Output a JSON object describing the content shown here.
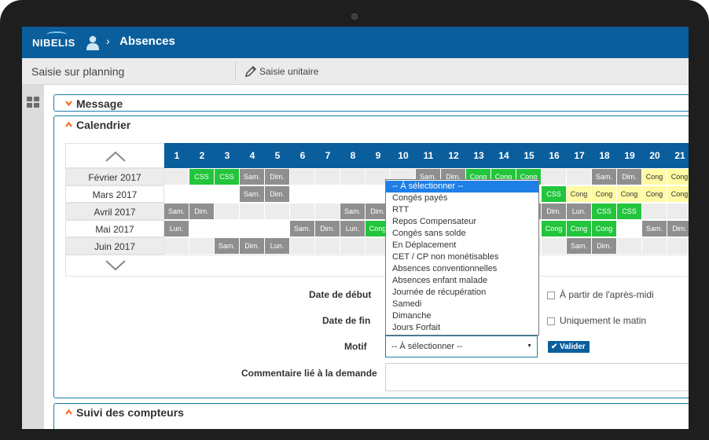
{
  "header": {
    "logo": "NIBELIS",
    "separator": "›",
    "title": "Absences"
  },
  "subheader": {
    "title": "Saisie sur planning",
    "action": "Saisie unitaire"
  },
  "panels": {
    "message": "Message",
    "calendrier": "Calendrier",
    "suivi": "Suivi des compteurs"
  },
  "calendar": {
    "days": [
      "1",
      "2",
      "3",
      "4",
      "5",
      "6",
      "7",
      "8",
      "9",
      "10",
      "11",
      "12",
      "13",
      "14",
      "15",
      "16",
      "17",
      "18",
      "19",
      "20",
      "21"
    ],
    "months": [
      {
        "label": "Février 2017",
        "cells": [
          {
            "d": 1,
            "t": "",
            "c": "light"
          },
          {
            "d": 2,
            "t": "CSS",
            "c": "green"
          },
          {
            "d": 3,
            "t": "CSS",
            "c": "green"
          },
          {
            "d": 4,
            "t": "Sam.",
            "c": "grey"
          },
          {
            "d": 5,
            "t": "Dim.",
            "c": "grey"
          },
          {
            "d": 6,
            "t": "",
            "c": "light"
          },
          {
            "d": 7,
            "t": "",
            "c": "light"
          },
          {
            "d": 8,
            "t": "",
            "c": "light"
          },
          {
            "d": 9,
            "t": "",
            "c": "light"
          },
          {
            "d": 10,
            "t": "",
            "c": "light"
          },
          {
            "d": 11,
            "t": "Sam.",
            "c": "grey"
          },
          {
            "d": 12,
            "t": "Dim.",
            "c": "grey"
          },
          {
            "d": 13,
            "t": "Cong",
            "c": "green"
          },
          {
            "d": 14,
            "t": "Cong",
            "c": "green"
          },
          {
            "d": 15,
            "t": "Cong",
            "c": "green"
          },
          {
            "d": 16,
            "t": "",
            "c": "light"
          },
          {
            "d": 17,
            "t": "",
            "c": "light"
          },
          {
            "d": 18,
            "t": "Sam.",
            "c": "grey"
          },
          {
            "d": 19,
            "t": "Dim.",
            "c": "grey"
          },
          {
            "d": 20,
            "t": "Cong",
            "c": "yellow"
          },
          {
            "d": 21,
            "t": "Cong",
            "c": "yellow"
          }
        ]
      },
      {
        "label": "Mars 2017",
        "cells": [
          {
            "d": 1,
            "t": "",
            "c": "white"
          },
          {
            "d": 2,
            "t": "",
            "c": "white"
          },
          {
            "d": 3,
            "t": "",
            "c": "white"
          },
          {
            "d": 4,
            "t": "Sam.",
            "c": "grey"
          },
          {
            "d": 5,
            "t": "Dim.",
            "c": "grey"
          },
          {
            "d": 6,
            "t": "",
            "c": "white"
          },
          {
            "d": 7,
            "t": "",
            "c": "white"
          },
          {
            "d": 8,
            "t": "",
            "c": "white"
          },
          {
            "d": 9,
            "t": "",
            "c": "white"
          },
          {
            "d": 10,
            "t": "",
            "c": "white"
          },
          {
            "d": 11,
            "t": "",
            "c": "white"
          },
          {
            "d": 12,
            "t": "",
            "c": "white"
          },
          {
            "d": 13,
            "t": "",
            "c": "white"
          },
          {
            "d": 14,
            "t": "",
            "c": "white"
          },
          {
            "d": 15,
            "t": "",
            "c": "white"
          },
          {
            "d": 16,
            "t": "CSS",
            "c": "green"
          },
          {
            "d": 17,
            "t": "Cong",
            "c": "yellow"
          },
          {
            "d": 18,
            "t": "Cong",
            "c": "yellow"
          },
          {
            "d": 19,
            "t": "Cong",
            "c": "yellow"
          },
          {
            "d": 20,
            "t": "Cong",
            "c": "yellow"
          },
          {
            "d": 21,
            "t": "Cong",
            "c": "yellow"
          }
        ]
      },
      {
        "label": "Avril 2017",
        "cells": [
          {
            "d": 1,
            "t": "Sam.",
            "c": "grey"
          },
          {
            "d": 2,
            "t": "Dim.",
            "c": "grey"
          },
          {
            "d": 3,
            "t": "",
            "c": "light"
          },
          {
            "d": 4,
            "t": "",
            "c": "light"
          },
          {
            "d": 5,
            "t": "",
            "c": "light"
          },
          {
            "d": 6,
            "t": "",
            "c": "light"
          },
          {
            "d": 7,
            "t": "",
            "c": "light"
          },
          {
            "d": 8,
            "t": "Sam.",
            "c": "grey"
          },
          {
            "d": 9,
            "t": "Dim.",
            "c": "grey"
          },
          {
            "d": 10,
            "t": "",
            "c": "light"
          },
          {
            "d": 11,
            "t": "",
            "c": "light"
          },
          {
            "d": 12,
            "t": "",
            "c": "light"
          },
          {
            "d": 13,
            "t": "",
            "c": "light"
          },
          {
            "d": 14,
            "t": "",
            "c": "light"
          },
          {
            "d": 15,
            "t": "Sam.",
            "c": "grey"
          },
          {
            "d": 16,
            "t": "Dim.",
            "c": "grey"
          },
          {
            "d": 17,
            "t": "Lun.",
            "c": "grey"
          },
          {
            "d": 18,
            "t": "CSS",
            "c": "green"
          },
          {
            "d": 19,
            "t": "CSS",
            "c": "green"
          },
          {
            "d": 20,
            "t": "",
            "c": "light"
          },
          {
            "d": 21,
            "t": "",
            "c": "light"
          }
        ]
      },
      {
        "label": "Mai 2017",
        "cells": [
          {
            "d": 1,
            "t": "Lun.",
            "c": "grey"
          },
          {
            "d": 2,
            "t": "",
            "c": "white"
          },
          {
            "d": 3,
            "t": "",
            "c": "white"
          },
          {
            "d": 4,
            "t": "",
            "c": "white"
          },
          {
            "d": 5,
            "t": "",
            "c": "white"
          },
          {
            "d": 6,
            "t": "Sam.",
            "c": "grey"
          },
          {
            "d": 7,
            "t": "Dim.",
            "c": "grey"
          },
          {
            "d": 8,
            "t": "Lun.",
            "c": "grey"
          },
          {
            "d": 9,
            "t": "Cong",
            "c": "green"
          },
          {
            "d": 10,
            "t": "",
            "c": "white"
          },
          {
            "d": 11,
            "t": "",
            "c": "white"
          },
          {
            "d": 12,
            "t": "",
            "c": "white"
          },
          {
            "d": 13,
            "t": "",
            "c": "white"
          },
          {
            "d": 14,
            "t": "",
            "c": "white"
          },
          {
            "d": 15,
            "t": "",
            "c": "white"
          },
          {
            "d": 16,
            "t": "Cong",
            "c": "green"
          },
          {
            "d": 17,
            "t": "Cong",
            "c": "green"
          },
          {
            "d": 18,
            "t": "Cong",
            "c": "green"
          },
          {
            "d": 19,
            "t": "",
            "c": "white"
          },
          {
            "d": 20,
            "t": "Sam.",
            "c": "grey"
          },
          {
            "d": 21,
            "t": "Dim.",
            "c": "grey"
          }
        ]
      },
      {
        "label": "Juin 2017",
        "cells": [
          {
            "d": 1,
            "t": "",
            "c": "light"
          },
          {
            "d": 2,
            "t": "",
            "c": "light"
          },
          {
            "d": 3,
            "t": "Sam.",
            "c": "grey"
          },
          {
            "d": 4,
            "t": "Dim.",
            "c": "grey"
          },
          {
            "d": 5,
            "t": "Lun.",
            "c": "grey"
          },
          {
            "d": 6,
            "t": "",
            "c": "light"
          },
          {
            "d": 7,
            "t": "",
            "c": "light"
          },
          {
            "d": 8,
            "t": "",
            "c": "light"
          },
          {
            "d": 9,
            "t": "",
            "c": "light"
          },
          {
            "d": 10,
            "t": "",
            "c": "light"
          },
          {
            "d": 11,
            "t": "",
            "c": "light"
          },
          {
            "d": 12,
            "t": "",
            "c": "light"
          },
          {
            "d": 13,
            "t": "",
            "c": "light"
          },
          {
            "d": 14,
            "t": "",
            "c": "light"
          },
          {
            "d": 15,
            "t": "",
            "c": "light"
          },
          {
            "d": 16,
            "t": "",
            "c": "light"
          },
          {
            "d": 17,
            "t": "Sam.",
            "c": "grey"
          },
          {
            "d": 18,
            "t": "Dim.",
            "c": "grey"
          },
          {
            "d": 19,
            "t": "",
            "c": "light"
          },
          {
            "d": 20,
            "t": "",
            "c": "light"
          },
          {
            "d": 21,
            "t": "",
            "c": "light"
          }
        ]
      }
    ]
  },
  "form": {
    "date_debut_label": "Date de début",
    "date_fin_label": "Date de fin",
    "motif_label": "Motif",
    "commentaire_label": "Commentaire lié à la demande",
    "apres_midi_label": "À partir de l'après-midi",
    "matin_label": "Uniquement le matin",
    "motif_value": "-- À sélectionner --",
    "valider_label": "Valider"
  },
  "dropdown": {
    "options": [
      "-- À sélectionner --",
      "Congés payés",
      "RTT",
      "Repos Compensateur",
      "Congés sans solde",
      "En Déplacement",
      "CET / CP non monétisables",
      "Absences conventionnelles",
      "Absences enfant malade",
      "Journée de récupération",
      "Samedi",
      "Dimanche",
      "Jours Forfait"
    ],
    "selected_index": 0
  },
  "colors": {
    "primary": "#0a5e9c",
    "accent_orange": "#f26b1d",
    "absence_green": "#22c53b",
    "conge_yellow": "#fffaa3",
    "weekend_grey": "#8f8f8f",
    "selected_blue": "#1e7fe6"
  },
  "icons": {
    "user": "user-icon",
    "pencil": "pencil-icon",
    "grid": "grid-icon",
    "chevron_collapsed": "chevron-down-icon",
    "chevron_expanded": "chevron-up-icon",
    "check": "check-icon"
  }
}
